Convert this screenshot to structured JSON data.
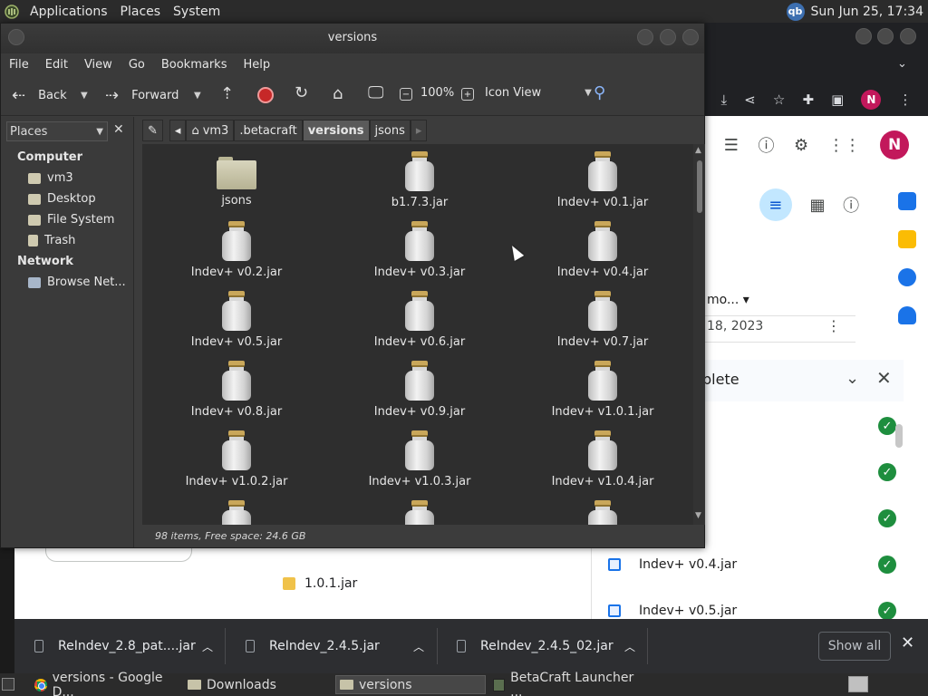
{
  "top_panel": {
    "menus": [
      "Applications",
      "Places",
      "System"
    ],
    "tray_icon": "qb",
    "clock": "Sun Jun 25, 17:34"
  },
  "chrome": {
    "google_drive": {
      "avatar": "N",
      "sort_label": "mo...",
      "date_label": "18, 2023",
      "file_row": "1.0.1.jar",
      "upload_panel": {
        "title": "plete",
        "items": [
          {
            "name": "",
            "status": "done"
          },
          {
            "name": "",
            "status": "done"
          },
          {
            "name": "",
            "status": "done"
          },
          {
            "name": "Indev+ v0.4.jar",
            "status": "done"
          },
          {
            "name": "Indev+ v0.5.jar",
            "status": "done"
          }
        ]
      }
    },
    "download_shelf": {
      "items": [
        "ReIndev_2.8_pat....jar",
        "ReIndev_2.4.5.jar",
        "ReIndev_2.4.5_02.jar"
      ],
      "show_all": "Show all"
    }
  },
  "caja": {
    "title": "versions",
    "menu": [
      "File",
      "Edit",
      "View",
      "Go",
      "Bookmarks",
      "Help"
    ],
    "toolbar": {
      "back": "Back",
      "forward": "Forward",
      "zoom": "100%",
      "view_mode": "Icon View"
    },
    "sidebar": {
      "header": "Places",
      "sections": [
        {
          "title": "Computer",
          "items": [
            "vm3",
            "Desktop",
            "File System",
            "Trash"
          ]
        },
        {
          "title": "Network",
          "items": [
            "Browse Net..."
          ]
        }
      ]
    },
    "path": [
      "vm3",
      ".betacraft",
      "versions",
      "jsons"
    ],
    "current_path_index": 2,
    "files": [
      {
        "name": "jsons",
        "type": "folder"
      },
      {
        "name": "b1.7.3.jar",
        "type": "jar"
      },
      {
        "name": "Indev+ v0.1.jar",
        "type": "jar"
      },
      {
        "name": "Indev+ v0.2.jar",
        "type": "jar"
      },
      {
        "name": "Indev+ v0.3.jar",
        "type": "jar"
      },
      {
        "name": "Indev+ v0.4.jar",
        "type": "jar"
      },
      {
        "name": "Indev+ v0.5.jar",
        "type": "jar"
      },
      {
        "name": "Indev+ v0.6.jar",
        "type": "jar"
      },
      {
        "name": "Indev+ v0.7.jar",
        "type": "jar"
      },
      {
        "name": "Indev+ v0.8.jar",
        "type": "jar"
      },
      {
        "name": "Indev+ v0.9.jar",
        "type": "jar"
      },
      {
        "name": "Indev+ v1.0.1.jar",
        "type": "jar"
      },
      {
        "name": "Indev+ v1.0.2.jar",
        "type": "jar"
      },
      {
        "name": "Indev+ v1.0.3.jar",
        "type": "jar"
      },
      {
        "name": "Indev+ v1.0.4.jar",
        "type": "jar"
      },
      {
        "name": "",
        "type": "jar"
      },
      {
        "name": "",
        "type": "jar"
      },
      {
        "name": "",
        "type": "jar"
      }
    ],
    "status": "98 items, Free space: 24.6 GB"
  },
  "taskbar": {
    "items": [
      "versions - Google D...",
      "Downloads",
      "versions",
      "BetaCraft Launcher ..."
    ],
    "active_index": 2
  }
}
